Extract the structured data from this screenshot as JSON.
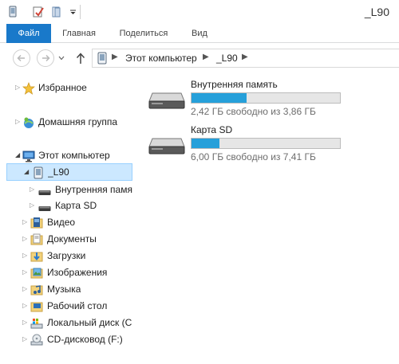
{
  "window": {
    "title": "_L90"
  },
  "ribbon": {
    "tabs": [
      "Файл",
      "Главная",
      "Поделиться",
      "Вид"
    ]
  },
  "address": {
    "crumbs": [
      "Этот компьютер",
      "_L90"
    ]
  },
  "nav": {
    "favorites": "Избранное",
    "homegroup": "Домашняя группа",
    "this_pc": "Этот компьютер",
    "device": "_L90",
    "internal": "Внутренняя памя",
    "sdcard": "Карта SD",
    "videos": "Видео",
    "documents": "Документы",
    "downloads": "Загрузки",
    "pictures": "Изображения",
    "music": "Музыка",
    "desktop": "Рабочий стол",
    "localdisk": "Локальный диск (С",
    "cdrom": "CD-дисковод (F:)"
  },
  "drives": [
    {
      "name": "Внутренняя память",
      "info": "2,42 ГБ свободно из 3,86 ГБ",
      "used_fraction": 0.373
    },
    {
      "name": "Карта SD",
      "info": "6,00 ГБ свободно из 7,41 ГБ",
      "used_fraction": 0.19
    }
  ],
  "colors": {
    "accent": "#1979ca",
    "usage_bar": "#26a0da",
    "selection": "#cce8ff"
  }
}
